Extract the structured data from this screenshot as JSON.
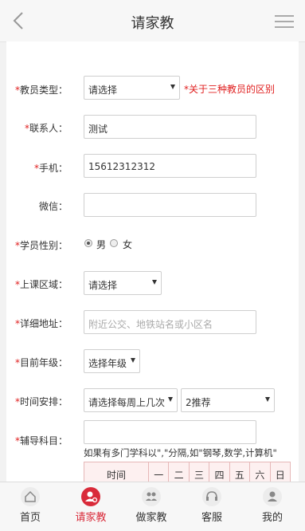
{
  "header": {
    "title": "请家教"
  },
  "form": {
    "teacher_type": {
      "label": "教员类型：",
      "value": "请选择",
      "note": "*关于三种教员的区别"
    },
    "contact": {
      "label": "联系人：",
      "value": "测试"
    },
    "phone": {
      "label": "手机：",
      "value": "15612312312"
    },
    "wechat": {
      "label": "微信：",
      "value": ""
    },
    "gender": {
      "label": "学员性别：",
      "options": [
        "男",
        "女"
      ],
      "selected": "男"
    },
    "area": {
      "label": "上课区域：",
      "value": "请选择"
    },
    "address": {
      "label": "详细地址：",
      "placeholder": "附近公交、地铁站名或小区名"
    },
    "grade": {
      "label": "目前年级：",
      "value": "选择年级"
    },
    "schedule": {
      "label": "时间安排：",
      "frequency": "请选择每周上几次",
      "recommend": "2推荐"
    },
    "subject": {
      "label": "辅导科目：",
      "value": "",
      "hint": "如果有多门学科以\",\"分隔,如\"钢琴,数学,计算机\""
    },
    "time_table": {
      "header": [
        "时间",
        "一",
        "二",
        "三",
        "四",
        "五",
        "六",
        "日"
      ]
    }
  },
  "required_mark": "*",
  "tabbar": {
    "items": [
      {
        "label": "首页",
        "icon": "home-icon"
      },
      {
        "label": "请家教",
        "icon": "hire-tutor-icon",
        "active": true
      },
      {
        "label": "做家教",
        "icon": "be-tutor-icon"
      },
      {
        "label": "客服",
        "icon": "service-icon"
      },
      {
        "label": "我的",
        "icon": "profile-icon"
      }
    ]
  },
  "colors": {
    "accent": "#d92b3a",
    "required": "#e02020"
  }
}
